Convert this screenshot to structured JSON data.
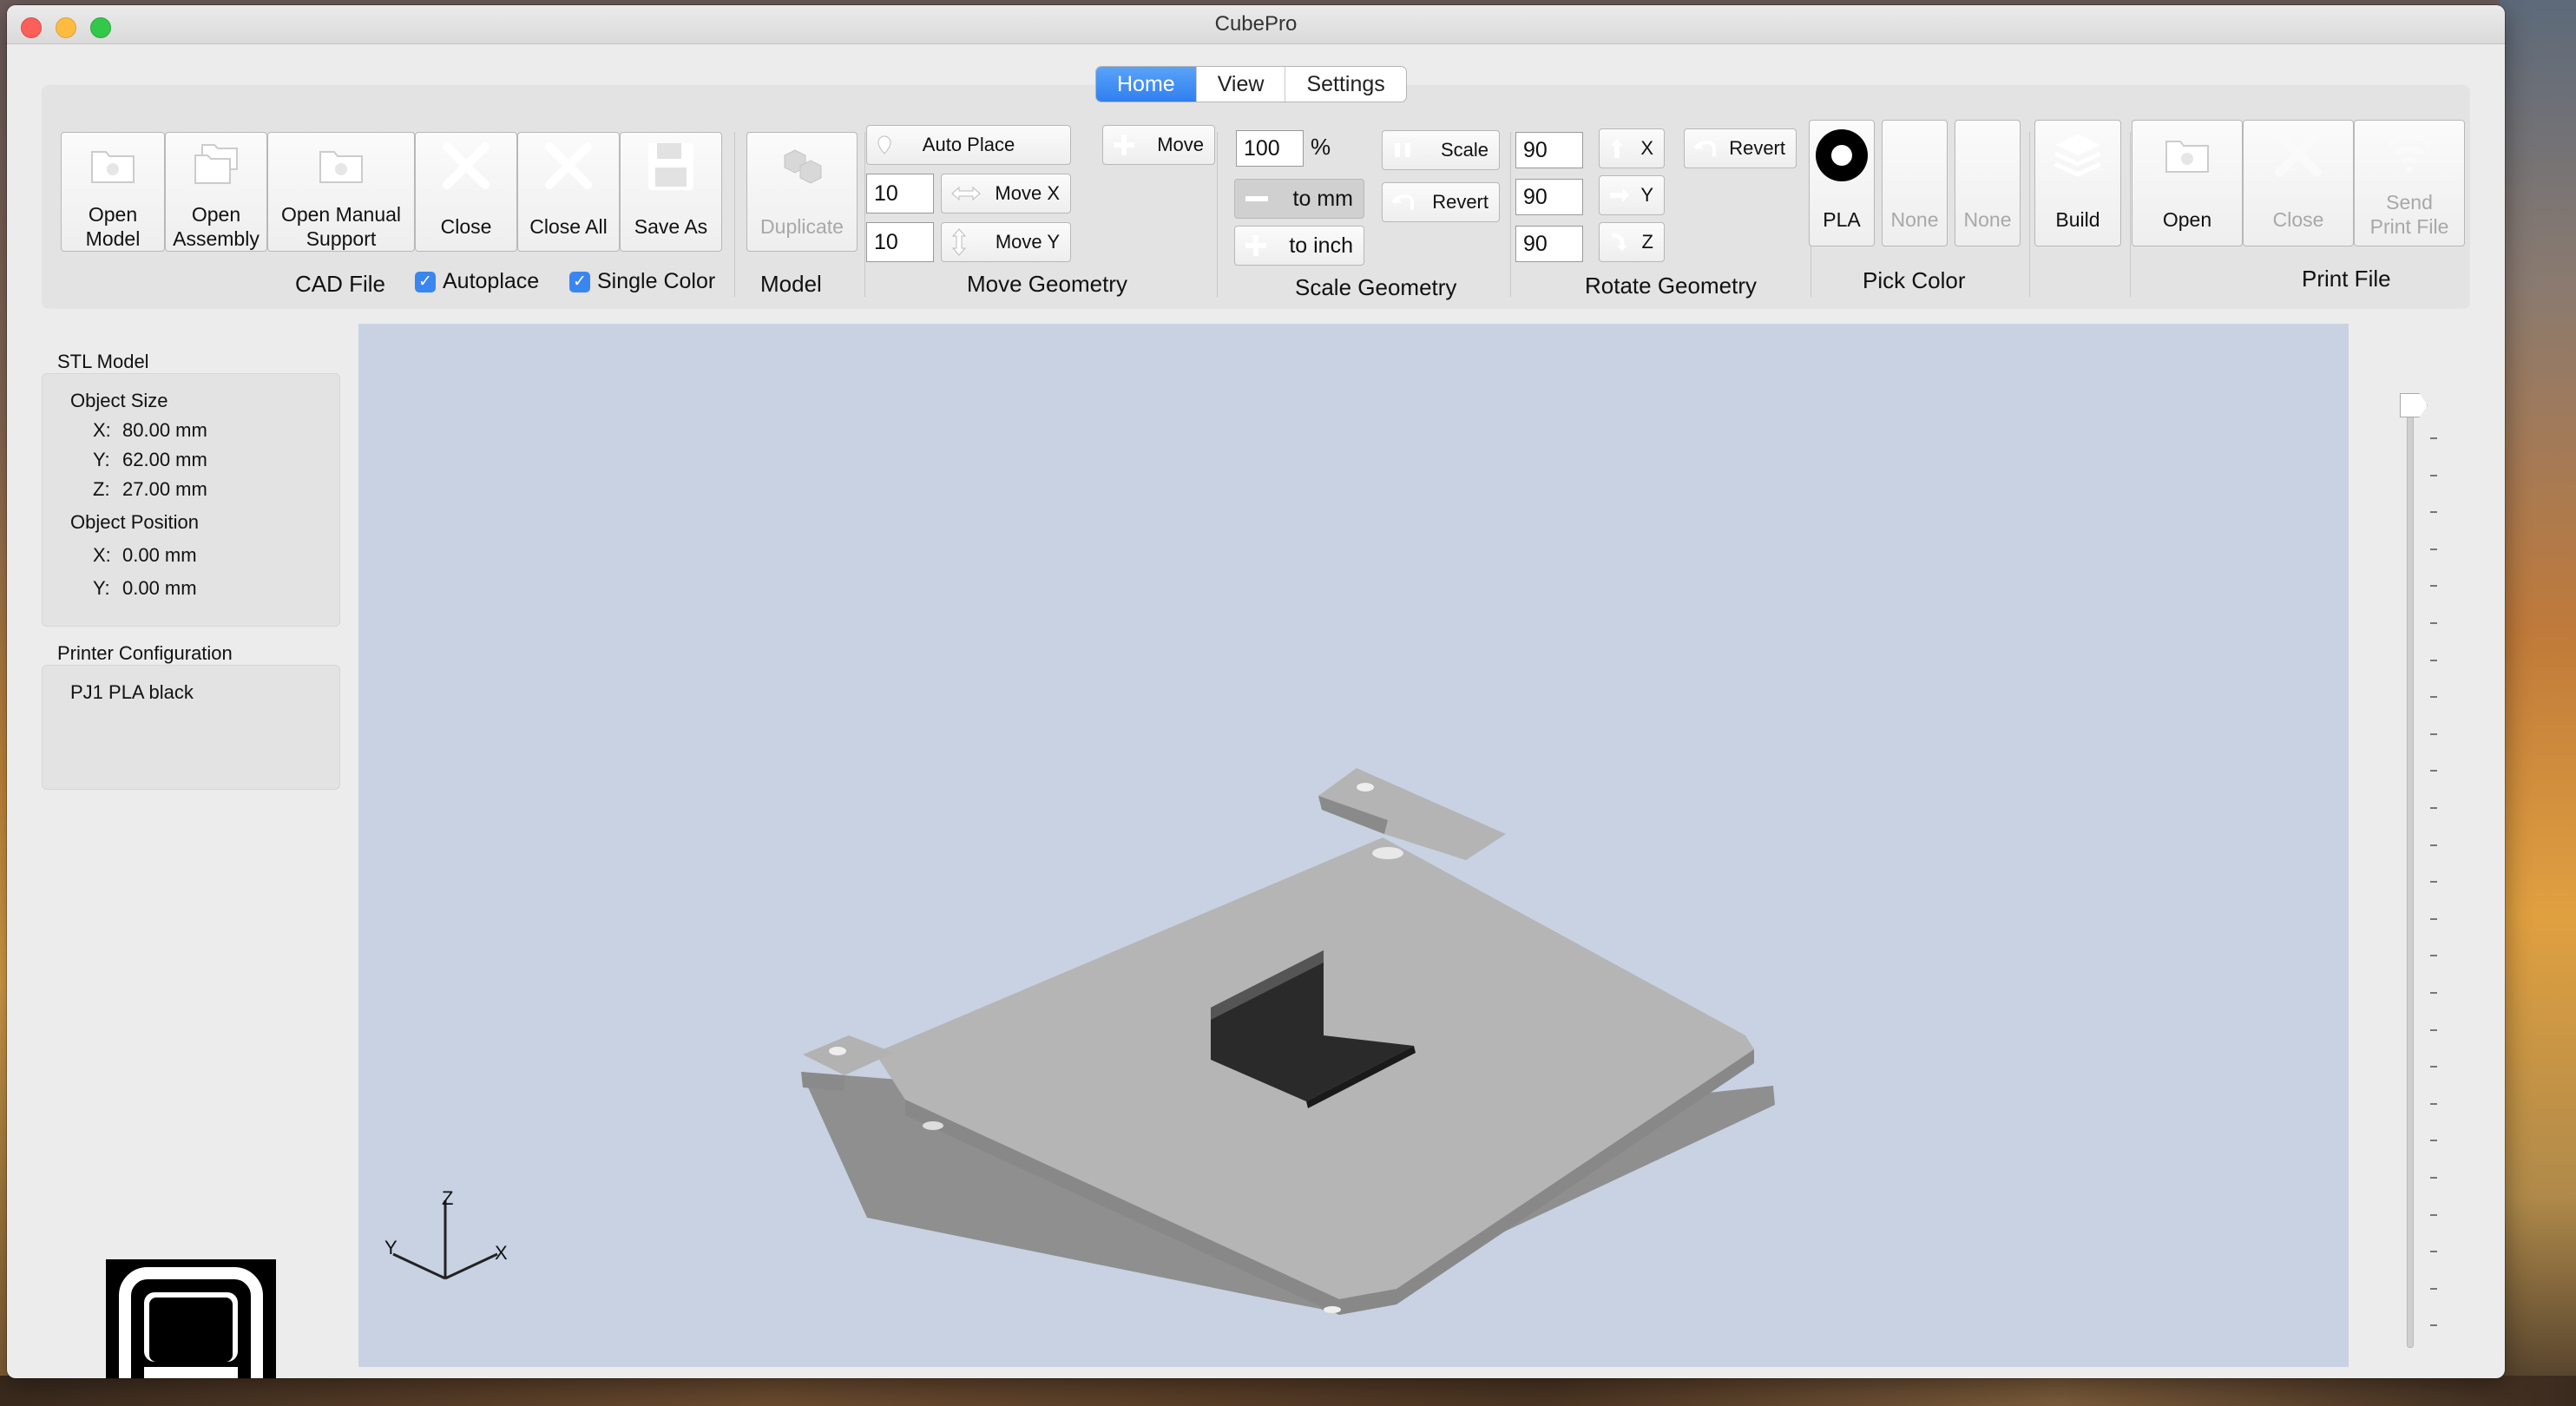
{
  "window": {
    "title": "CubePro"
  },
  "tabs": [
    {
      "label": "Home",
      "active": true
    },
    {
      "label": "View",
      "active": false
    },
    {
      "label": "Settings",
      "active": false
    }
  ],
  "cad_file": {
    "group_label": "CAD File",
    "buttons": [
      {
        "label": "Open\nModel",
        "icon": "open-model-icon"
      },
      {
        "label": "Open\nAssembly",
        "icon": "open-assembly-icon"
      },
      {
        "label": "Open Manual\nSupport",
        "icon": "open-support-icon"
      },
      {
        "label": "Close",
        "icon": "close-icon"
      },
      {
        "label": "Close All",
        "icon": "close-all-icon"
      },
      {
        "label": "Save As",
        "icon": "save-icon"
      }
    ],
    "autoplace_label": "Autoplace",
    "single_color_label": "Single Color"
  },
  "model": {
    "group_label": "Model",
    "duplicate_label": "Duplicate"
  },
  "move_geometry": {
    "group_label": "Move Geometry",
    "auto_place_label": "Auto Place",
    "move_label": "Move",
    "move_x_value": "10",
    "move_y_value": "10",
    "move_x_label": "Move X",
    "move_y_label": "Move Y"
  },
  "scale_geometry": {
    "group_label": "Scale Geometry",
    "percent_value": "100",
    "percent_sign": "%",
    "scale_label": "Scale",
    "revert_label": "Revert",
    "to_mm_label": "to mm",
    "to_inch_label": "to inch"
  },
  "rotate_geometry": {
    "group_label": "Rotate Geometry",
    "x_value": "90",
    "y_value": "90",
    "z_value": "90",
    "x_label": "X",
    "y_label": "Y",
    "z_label": "Z",
    "revert_label": "Revert"
  },
  "pick_color": {
    "group_label": "Pick Color",
    "slots": [
      "PLA",
      "None",
      "None"
    ]
  },
  "build": {
    "label": "Build"
  },
  "print_file": {
    "group_label": "Print File",
    "open_label": "Open",
    "close_label": "Close",
    "send_label": "Send\nPrint File"
  },
  "stl_model": {
    "title": "STL Model",
    "object_size_label": "Object Size",
    "size": [
      {
        "axis": "X:",
        "value": "80.00 mm"
      },
      {
        "axis": "Y:",
        "value": "62.00 mm"
      },
      {
        "axis": "Z:",
        "value": "27.00 mm"
      }
    ],
    "object_position_label": "Object Position",
    "position": [
      {
        "axis": "X:",
        "value": "0.00 mm"
      },
      {
        "axis": "Y:",
        "value": "0.00 mm"
      }
    ]
  },
  "printer_configuration": {
    "title": "Printer Configuration",
    "value": "PJ1 PLA black"
  },
  "axis_indicator": {
    "x": "X",
    "y": "Y",
    "z": "Z"
  },
  "layer_slider": {
    "position": 0
  }
}
